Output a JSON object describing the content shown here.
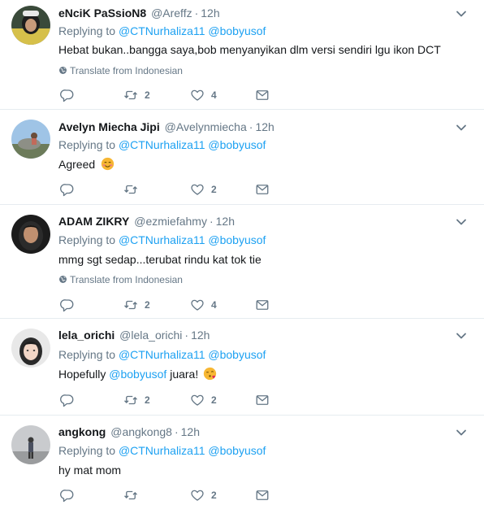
{
  "colors": {
    "link": "#1da1f2",
    "muted": "#657786",
    "border": "#e6ecf0"
  },
  "tweets": [
    {
      "name": "eNciK PaSsioN8",
      "handle": "@Areffz",
      "time": "12h",
      "replying_label": "Replying to",
      "mentions": [
        "@CTNurhaliza11",
        "@bobyusof"
      ],
      "text": "Hebat bukan..bangga saya,bob menyanyikan dlm versi sendiri lgu ikon DCT",
      "translate": "Translate from Indonesian",
      "reply_count": "",
      "retweet_count": "2",
      "like_count": "4"
    },
    {
      "name": "Avelyn Miecha Jipi",
      "handle": "@Avelynmiecha",
      "time": "12h",
      "replying_label": "Replying to",
      "mentions": [
        "@CTNurhaliza11",
        "@bobyusof"
      ],
      "text": "Agreed",
      "emoji": "smiling-face-icon",
      "reply_count": "",
      "retweet_count": "",
      "like_count": "2"
    },
    {
      "name": "ADAM ZIKRY",
      "handle": "@ezmiefahmy",
      "time": "12h",
      "replying_label": "Replying to",
      "mentions": [
        "@CTNurhaliza11",
        "@bobyusof"
      ],
      "text": "mmg sgt sedap...terubat rindu kat tok tie",
      "translate": "Translate from Indonesian",
      "reply_count": "",
      "retweet_count": "2",
      "like_count": "4"
    },
    {
      "name": "lela_orichi",
      "handle": "@lela_orichi",
      "time": "12h",
      "replying_label": "Replying to",
      "mentions": [
        "@CTNurhaliza11",
        "@bobyusof"
      ],
      "text_before": "Hopefully",
      "text_mention": "@bobyusof",
      "text_after": "juara!",
      "emoji": "kissing-face-icon",
      "reply_count": "",
      "retweet_count": "2",
      "like_count": "2"
    },
    {
      "name": "angkong",
      "handle": "@angkong8",
      "time": "12h",
      "replying_label": "Replying to",
      "mentions": [
        "@CTNurhaliza11",
        "@bobyusof"
      ],
      "text": "hy mat mom",
      "reply_count": "",
      "retweet_count": "",
      "like_count": "2"
    }
  ],
  "dot": "·"
}
